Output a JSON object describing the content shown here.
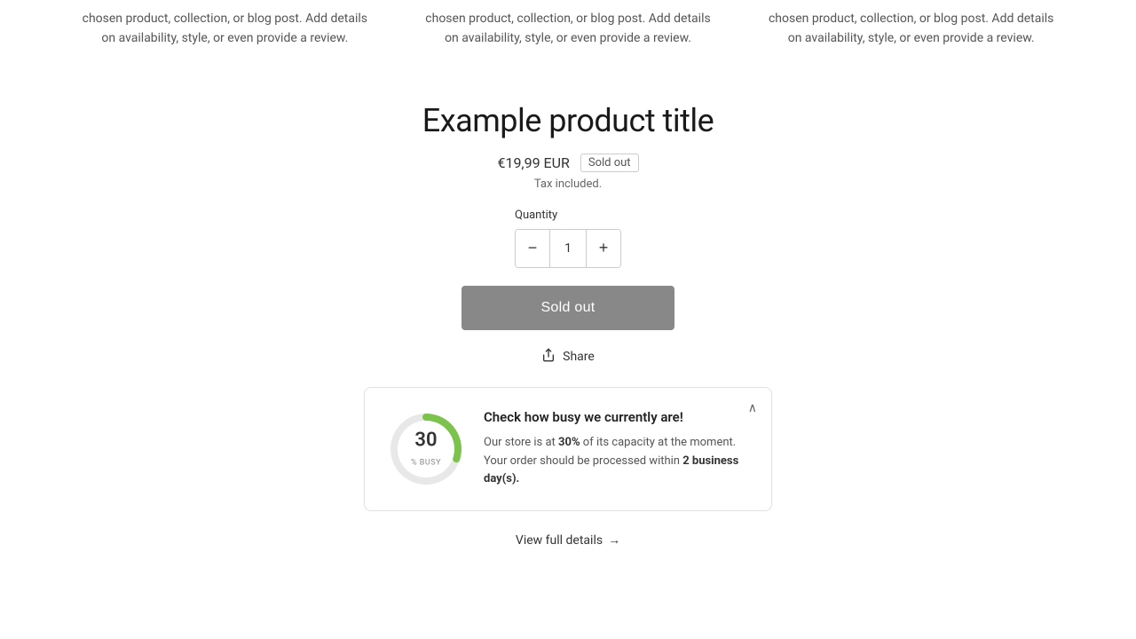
{
  "review_cards": [
    {
      "text": "chosen product, collection, or blog post. Add details on availability, style, or even provide a review."
    },
    {
      "text": "chosen product, collection, or blog post. Add details on availability, style, or even provide a review."
    },
    {
      "text": "chosen product, collection, or blog post. Add details on availability, style, or even provide a review."
    }
  ],
  "product": {
    "title": "Example product title",
    "price": "€19,99 EUR",
    "sold_out_badge": "Sold out",
    "tax_info": "Tax included.",
    "quantity_label": "Quantity",
    "quantity_value": "1",
    "sold_out_button": "Sold out",
    "share_label": "Share"
  },
  "busy_widget": {
    "title": "Check how busy we currently are!",
    "description_prefix": "Our store is at ",
    "percent": "30%",
    "description_middle": " of its capacity at the moment. Your order should be processed within ",
    "days": "2 business day(s).",
    "percent_number": "30",
    "percent_label": "% BUSY",
    "donut_percent": 30,
    "collapse_icon": "∧"
  },
  "view_full_details": {
    "label": "View full details",
    "arrow": "→"
  },
  "icons": {
    "minus": "−",
    "plus": "+",
    "share": "⎋",
    "chevron_up": "∧"
  }
}
